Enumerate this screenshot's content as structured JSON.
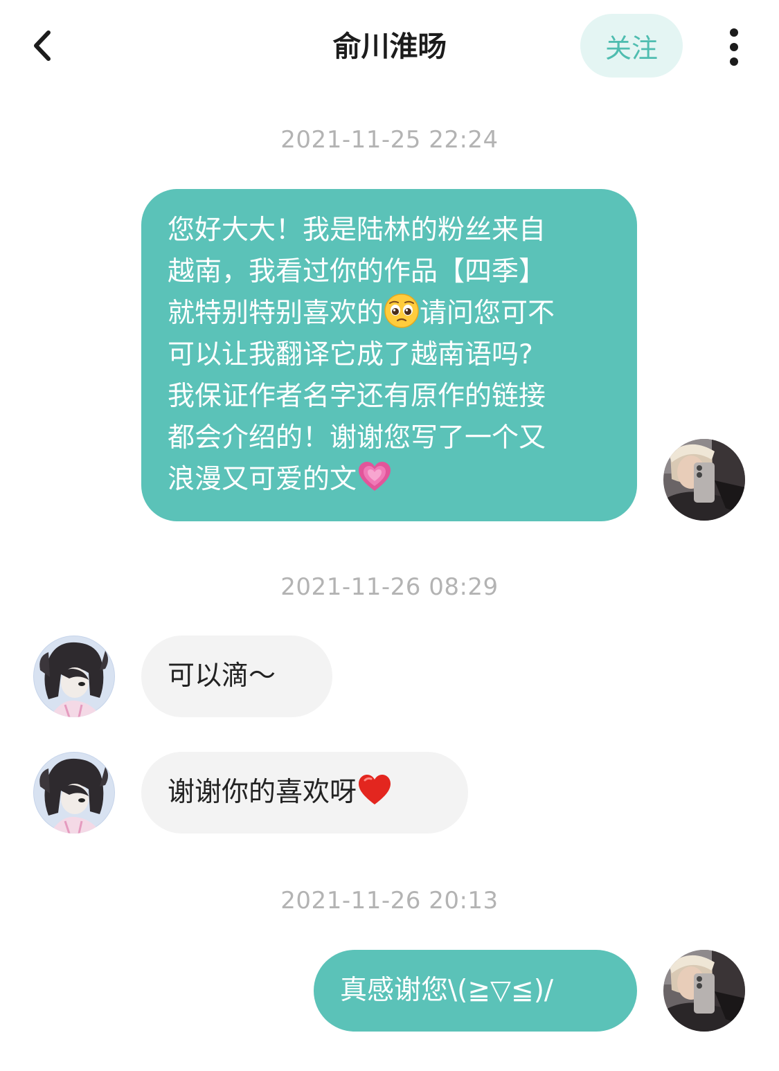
{
  "header": {
    "title": "俞川淮旸",
    "follow_label": "关注"
  },
  "colors": {
    "sent_bubble": "#5bc2b8",
    "received_bubble": "#f3f3f3",
    "follow_bg": "#e4f5f3",
    "follow_text": "#4fbdb0",
    "timestamp": "#b3b3b3"
  },
  "icons": {
    "back": "chevron-left-icon",
    "more": "more-vertical-icon",
    "emoji_pleading": "pleading-face-emoji",
    "emoji_growing_heart": "growing-heart-emoji",
    "emoji_red_heart": "red-heart-emoji"
  },
  "timestamps": [
    "2021-11-25 22:24",
    "2021-11-26 08:29",
    "2021-11-26 20:13"
  ],
  "messages": [
    {
      "direction": "sent",
      "lines": [
        "您好大大！我是陆林的粉丝来自",
        "越南，我看过你的作品【四季】",
        "就特别特别喜欢的",
        "请问您可不",
        "可以让我翻译它成了越南语吗?",
        "我保证作者名字还有原作的链接",
        "都会介绍的！谢谢您写了一个又",
        "浪漫又可爱的文"
      ]
    },
    {
      "direction": "received",
      "text": "可以滴～"
    },
    {
      "direction": "received",
      "text": "谢谢你的喜欢呀"
    },
    {
      "direction": "sent",
      "text": "真感谢您\\(≧▽≦)/"
    }
  ]
}
